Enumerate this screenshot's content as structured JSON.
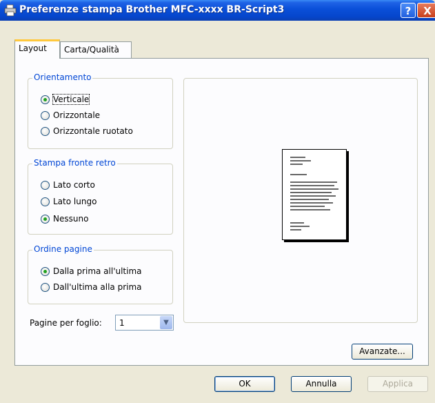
{
  "window": {
    "title": "Preferenze stampa Brother MFC-xxxx BR-Script3",
    "help_label": "?",
    "close_label": "X"
  },
  "tabs": [
    {
      "label": "Layout"
    },
    {
      "label": "Carta/Qualità"
    }
  ],
  "orientation": {
    "title": "Orientamento",
    "options": [
      {
        "label": "Verticale",
        "checked": true
      },
      {
        "label": "Orizzontale",
        "checked": false
      },
      {
        "label": "Orizzontale ruotato",
        "checked": false
      }
    ]
  },
  "duplex": {
    "title": "Stampa fronte retro",
    "options": [
      {
        "label": "Lato corto",
        "checked": false
      },
      {
        "label": "Lato lungo",
        "checked": false
      },
      {
        "label": "Nessuno",
        "checked": true
      }
    ]
  },
  "page_order": {
    "title": "Ordine pagine",
    "options": [
      {
        "label": "Dalla prima all'ultima",
        "checked": true
      },
      {
        "label": "Dall'ultima alla prima",
        "checked": false
      }
    ]
  },
  "pages_per_sheet": {
    "label": "Pagine per foglio:",
    "value": "1"
  },
  "buttons": {
    "advanced": "Avanzate...",
    "ok": "OK",
    "cancel": "Annulla",
    "apply": "Applica"
  }
}
